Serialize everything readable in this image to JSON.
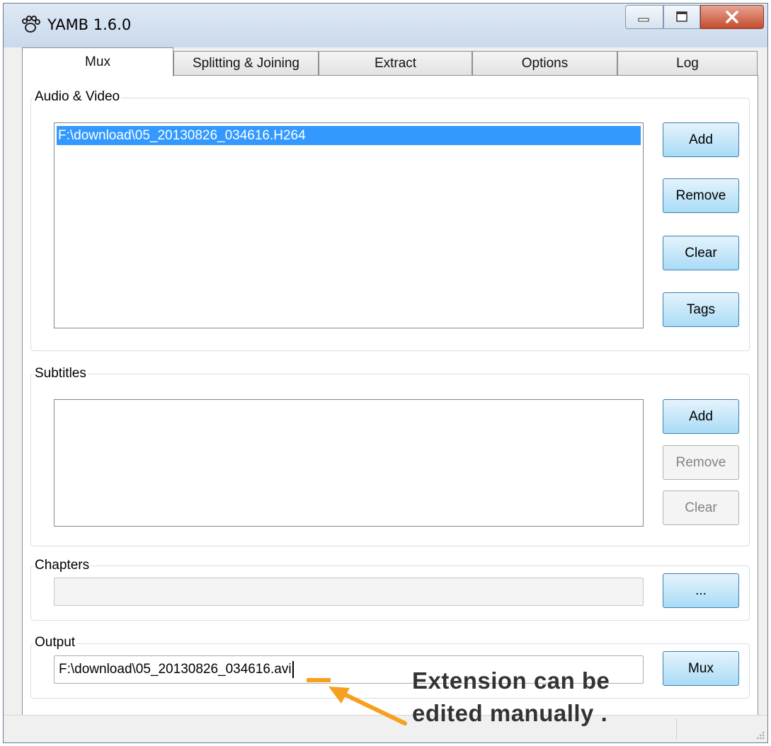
{
  "window": {
    "title": "YAMB 1.6.0",
    "icon": "paw-icon",
    "controls": [
      "minimize-icon",
      "maximize-icon",
      "close-icon"
    ]
  },
  "tabs": [
    {
      "label": "Mux",
      "active": true
    },
    {
      "label": "Splitting & Joining",
      "active": false
    },
    {
      "label": "Extract",
      "active": false
    },
    {
      "label": "Options",
      "active": false
    },
    {
      "label": "Log",
      "active": false
    }
  ],
  "audio_video": {
    "label": "Audio & Video",
    "items": [
      "F:\\download\\05_20130826_034616.H264"
    ],
    "buttons": {
      "add": "Add",
      "remove": "Remove",
      "clear": "Clear",
      "tags": "Tags"
    }
  },
  "subtitles": {
    "label": "Subtitles",
    "buttons": {
      "add": "Add",
      "remove": "Remove",
      "clear": "Clear"
    }
  },
  "chapters": {
    "label": "Chapters",
    "value": "",
    "browse_label": "..."
  },
  "output": {
    "label": "Output",
    "value": "F:\\download\\05_20130826_034616.avi",
    "mux_label": "Mux"
  },
  "annotation": {
    "line1": "Extension can be",
    "line2": "edited manually .",
    "color": "#f5a01e"
  }
}
